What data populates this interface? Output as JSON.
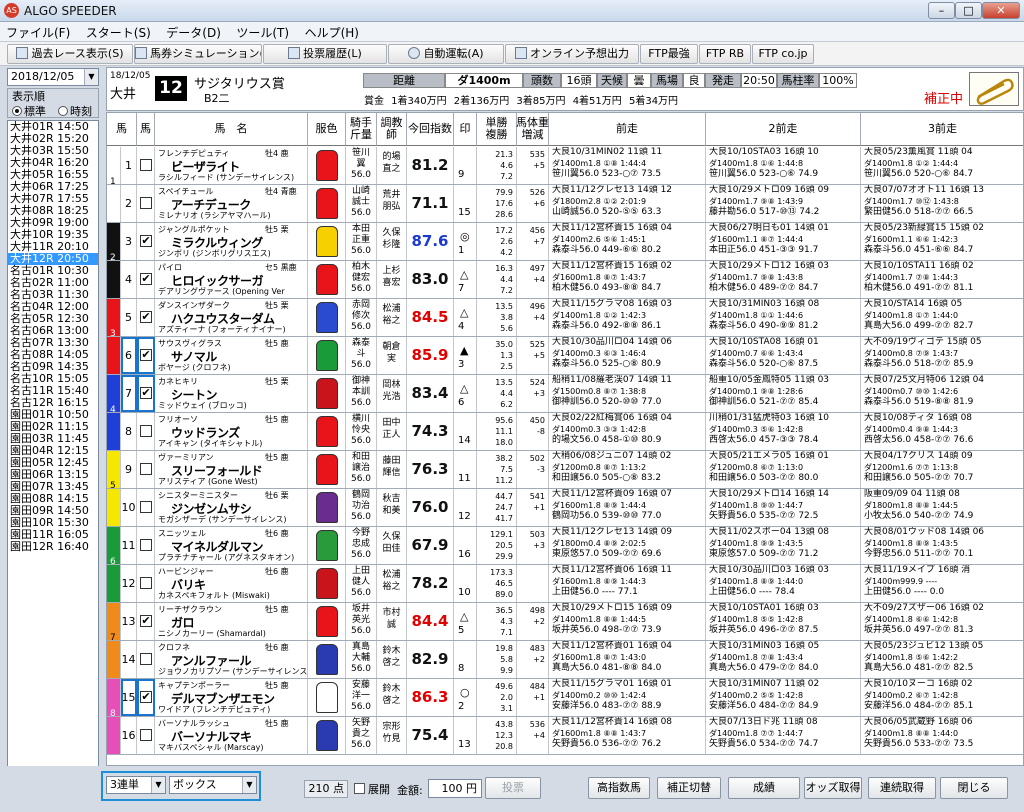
{
  "window": {
    "title": "ALGO SPEEDER",
    "app_icon": "AS"
  },
  "menu": [
    "ファイル(F)",
    "スタート(S)",
    "データ(D)",
    "ツール(T)",
    "ヘルプ(H)"
  ],
  "toolbar": [
    {
      "label": "過去レース表示(S)",
      "icon": "search-icon"
    },
    {
      "label": "馬券シミュレーション(B)",
      "icon": "calculator-icon"
    },
    {
      "label": "投票履歴(L)",
      "icon": "document-icon"
    },
    {
      "label": "自動運転(A)",
      "icon": "clock-icon"
    },
    {
      "label": "オンライン予想出力",
      "icon": "document-icon"
    },
    {
      "label": "FTP最強"
    },
    {
      "label": "FTP RB"
    },
    {
      "label": "FTP co.jp"
    }
  ],
  "sidebar": {
    "date": "2018/12/05",
    "order_label": "表示順",
    "order_options": [
      "標準",
      "時刻"
    ],
    "order_selected": "標準",
    "races": [
      "大井01R 14:50",
      "大井02R 15:20",
      "大井03R 15:50",
      "大井04R 16:20",
      "大井05R 16:55",
      "大井06R 17:25",
      "大井07R 17:55",
      "大井08R 18:25",
      "大井09R 19:00",
      "大井10R 19:35",
      "大井11R 20:10",
      "大井12R 20:50",
      "名古01R 10:30",
      "名古02R 11:00",
      "名古03R 11:30",
      "名古04R 12:00",
      "名古05R 12:30",
      "名古06R 13:00",
      "名古07R 13:30",
      "名古08R 14:05",
      "名古09R 14:35",
      "名古10R 15:05",
      "名古11R 15:40",
      "名古12R 16:15",
      "園田01R 10:50",
      "園田02R 11:15",
      "園田03R 11:45",
      "園田04R 12:15",
      "園田05R 12:45",
      "園田06R 13:15",
      "園田07R 13:45",
      "園田08R 14:15",
      "園田09R 14:50",
      "園田10R 15:30",
      "園田11R 16:05",
      "園田12R 16:40"
    ],
    "selected_race": "大井12R 20:50"
  },
  "race": {
    "date": "18/12/05",
    "venue": "大井",
    "number": "12",
    "name": "サジタリウス賞",
    "class": "B2二",
    "distance_label": "距離",
    "distance": "ダ1400m",
    "runners_label": "頭数",
    "runners": "16頭",
    "weather_label": "天候",
    "weather": "曇",
    "going_label": "馬場",
    "going": "良",
    "post_time_label": "発走",
    "post_time": "20:50",
    "post_rate_label": "馬柱率",
    "post_rate": "100%",
    "prizes": "賞金 1着340万円 2着136万円 3着85万円 4着51万円 5着34万円",
    "status": "補正中"
  },
  "columns": [
    "馬",
    "馬",
    "馬　名",
    "服色",
    "騎手\n斤量",
    "調教\n師",
    "今回指数",
    "印",
    "単勝\n複勝",
    "馬体重\n増減",
    "前走",
    "2前走",
    "3前走"
  ],
  "horses": [
    {
      "waku": "1",
      "num": "1",
      "checked": false,
      "sire": "フレンチデピュティ",
      "sex_age": "牡4 鹿",
      "name": "ビーザライト",
      "dam": "ラシルフィード (サンデーサイレンス)",
      "jockey": "笹川\n翼\n56.0",
      "trainer": "的場\n直之",
      "index": "81.2",
      "mark": "",
      "pop": "9",
      "odds": "21.3\n4.6\n7.2",
      "weight": "535\n+5\n",
      "p1": [
        "大良10/31MIN02 11頭 11",
        "ダ1400m1.8 ①⑧ 1:44:4",
        "笹川翼56.0 523-○⑦ 73.5"
      ],
      "p2": [
        "大良10/10STA03 16頭 10",
        "ダ1400m1.8 ①⑥ 1:44:8",
        "笹川翼56.0 523-○⑥ 74.9"
      ],
      "p3": [
        "大良05/23薫風賞 11頭 04",
        "ダ1400m1.8 ①② 1:44:4",
        "笹川翼56.0 520-○⑥ 84.7"
      ]
    },
    {
      "waku": "1",
      "num": "2",
      "checked": false,
      "sire": "スペイチュール",
      "sex_age": "牡4 青鹿",
      "name": "アーチデューク",
      "dam": "ミレナリオ (ラシアヤマハール)",
      "jockey": "山崎\n誠士\n56.0",
      "trainer": "荒井\n朋弘",
      "index": "71.1",
      "mark": "",
      "pop": "15",
      "odds": "79.9\n17.6\n28.6",
      "weight": "526\n+6\n",
      "p1": [
        "大良11/12クレセ13 14頭 12",
        "ダ1800m2.8 ①② 2:01:9",
        "山崎誠56.0 520-⑤⑤ 63.3"
      ],
      "p2": [
        "大良10/29メトロ09 16頭 09",
        "ダ1400m1.7 ⑨⑧ 1:43:9",
        "藤井勘56.0 517-⑩⑬ 74.2"
      ],
      "p3": [
        "大良07/07オオト11 16頭 13",
        "ダ1400m1.7 ⑩⑫ 1:43:8",
        "繁田健56.0 518-⑦⑦ 66.5"
      ]
    },
    {
      "waku": "2",
      "num": "3",
      "checked": true,
      "sire": "ジャングルポケット",
      "sex_age": "牡5 栗",
      "name": "ミラクルウィング",
      "dam": "ジンボリ (ジンボリグリスエス)",
      "jockey": "本田\n正重\n56.0",
      "trainer": "久保\n杉隆",
      "index": "87.6",
      "mark": "◎",
      "pop": "1",
      "odds": "17.2\n2.6\n4.2",
      "weight": "456\n+7\n",
      "p1": [
        "大良11/12宮杯貴15 16頭 04",
        "ダ1400m2.6 ⑤⑥ 1:45:1",
        "森泰斗56.0 449-⑥⑥ 80.2"
      ],
      "p2": [
        "大良06/27明日も01 14頭 01",
        "ダ1600m1.1 ⑧⑦ 1:44:4",
        "本田正56.0 451-③③ 91.7"
      ],
      "p3": [
        "大良05/23新緑賞15 15頭 02",
        "ダ1600m1.1 ⑥⑥ 1:42:3",
        "森泰斗56.0 451-⑥⑥ 84.7"
      ]
    },
    {
      "waku": "2",
      "num": "4",
      "checked": true,
      "sire": "パイロ",
      "sex_age": "セ5 黒鹿",
      "name": "ヒロイックサーガ",
      "dam": "デアリングヴァース (Opening Ver",
      "jockey": "柏木\n健宏\n56.0",
      "trainer": "上杉\n喜宏",
      "index": "83.0",
      "mark": "△",
      "pop": "7",
      "odds": "16.3\n4.4\n7.2",
      "weight": "497\n+4\n",
      "p1": [
        "大良11/12宮杯貴15 16頭 02",
        "ダ1600m1.8 ⑧⑦ 1:43:7",
        "柏木健56.0 493-⑧⑧ 84.7"
      ],
      "p2": [
        "大良10/29メトロ12 16頭 03",
        "ダ1400m1.7 ⑨⑧ 1:43:8",
        "柏木健56.0 489-⑦⑦ 84.7"
      ],
      "p3": [
        "大良10/10STA11 16頭 02",
        "ダ1400m1.7 ⑦⑧ 1:44:3",
        "柏木健56.0 491-⑦⑦ 81.1"
      ]
    },
    {
      "waku": "3",
      "num": "5",
      "checked": true,
      "sire": "ダンスインザダーク",
      "sex_age": "牡5 栗",
      "name": "ハクユウスターダム",
      "dam": "アズティーナ (フォーティナイナー)",
      "jockey": "赤岡\n修次\n56.0",
      "trainer": "松浦\n裕之",
      "index": "84.5",
      "mark": "△",
      "pop": "4",
      "odds": "13.5\n3.8\n5.6",
      "weight": "496\n+4\n",
      "p1": [
        "大良11/15グラマ08 16頭 03",
        "ダ1400m1.8 ①② 1:42:3",
        "森泰斗56.0 492-⑧⑧ 86.1"
      ],
      "p2": [
        "大良10/31MIN03 16頭 08",
        "ダ1400m1.8 ①① 1:44:6",
        "森泰斗56.0 490-⑨⑨ 81.2"
      ],
      "p3": [
        "大良10/STA14 16頭 05",
        "ダ1400m1.8 ①⑦ 1:44:0",
        "真島大56.0 499-⑦⑦ 82.7"
      ]
    },
    {
      "waku": "3",
      "num": "6",
      "checked": true,
      "sire": "サウスヴィグラス",
      "sex_age": "牡5 鹿",
      "name": "サノマル",
      "dam": "ボヤージ (クロフネ)",
      "jockey": "森泰\n斗\n56.0",
      "trainer": "朝倉\n実",
      "index": "85.9",
      "mark": "▲",
      "pop": "3",
      "odds": "35.0\n1.3\n2.5",
      "weight": "525\n+5\n",
      "p1": [
        "大良10/30品川ロ04 14頭 06",
        "ダ1400m0.3 ⑥③ 1:46:4",
        "森泰斗56.0 525-○⑧ 80.9"
      ],
      "p2": [
        "大良10/10STA08 16頭 01",
        "ダ1400m0.7 ⑥⑥ 1:43:4",
        "森泰斗56.0 520-○⑥ 87.5"
      ],
      "p3": [
        "大不09/19ヴィゴテ 15頭 05",
        "ダ1400m0.8 ⑦⑨ 1:43:7",
        "森泰斗56.0 518-⑦⑦ 85.9"
      ]
    },
    {
      "waku": "4",
      "num": "7",
      "checked": true,
      "sire": "カネヒキリ",
      "sex_age": "牡5 栗",
      "name": "シートン",
      "dam": "ミッドウェイ (ブロッコ)",
      "jockey": "御神\n本訓\n56.0",
      "trainer": "岡林\n光浩",
      "index": "83.4",
      "mark": "△",
      "pop": "6",
      "odds": "13.5\n4.4\n6.2",
      "weight": "524\n+3\n",
      "p1": [
        "船稍11/08羅老渓07 14頭 11",
        "ダ1500m0.8 ⑧⑦ 1:38:8",
        "御神訓56.0 520-⑩⑩ 77.0"
      ],
      "p2": [
        "船重10/05金鳳特05 11頭 03",
        "ダ1400m0.1 ⑨⑧ 1:28:6",
        "御神訓56.0 521-⑦⑦ 85.4"
      ],
      "p3": [
        "大良07/25文月特06 12頭 04",
        "ダ1400m0.7 ⑩⑩ 1:42:6",
        "森泰斗56.0 519-⑧⑧ 81.9"
      ]
    },
    {
      "waku": "4",
      "num": "8",
      "checked": false,
      "sire": "フリオーソ",
      "sex_age": "牡5 鹿",
      "name": "ウッドランズ",
      "dam": "アイキャン (タイキシャトル)",
      "jockey": "横川\n怜央\n56.0",
      "trainer": "田中\n正人",
      "index": "74.3",
      "mark": "",
      "pop": "14",
      "odds": "95.6\n11.1\n18.0",
      "weight": "450\n-8\n",
      "p1": [
        "大良02/22紅梅賞06 16頭 04",
        "ダ1400m0.3 ③③ 1:42:8",
        "的場文56.0 458-①⑩ 80.9"
      ],
      "p2": [
        "川稍01/31猛虎特03 16頭 10",
        "ダ1400m0.3 ⑤⑥ 1:42:8",
        "西啓太56.0 457-③③ 78.4"
      ],
      "p3": [
        "大良10/08ティタ 16頭 08",
        "ダ1400m0.4 ⑨⑧ 1:44:3",
        "西啓太56.0 458-⑦⑦ 76.6"
      ]
    },
    {
      "waku": "5",
      "num": "9",
      "checked": false,
      "sire": "ヴァーミリアン",
      "sex_age": "牡5 鹿",
      "name": "スリーフォールド",
      "dam": "アリスティア (Gone West)",
      "jockey": "和田\n譲治\n56.0",
      "trainer": "藤田\n輝信",
      "index": "76.3",
      "mark": "",
      "pop": "11",
      "odds": "38.2\n7.5\n11.2",
      "weight": "502\n-3\n",
      "p1": [
        "大稍06/08ジュニ07 14頭 02",
        "ダ1200m0.8 ⑧⑦ 1:13:2",
        "和田譲56.0 505-○⑧ 83.2"
      ],
      "p2": [
        "大良05/21エメラ05 16頭 01",
        "ダ1200m0.8 ⑥⑦ 1:13:0",
        "和田譲56.0 503-⑦⑦ 80.0"
      ],
      "p3": [
        "大良04/17クリス 14頭 09",
        "ダ1200m1.6 ⑦⑦ 1:13:8",
        "和田譲56.0 505-⑦⑦ 70.7"
      ]
    },
    {
      "waku": "5",
      "num": "10",
      "checked": false,
      "sire": "シニスターミニスター",
      "sex_age": "牡6 栗",
      "name": "ジンゼンムサシ",
      "dam": "モガシザーデ (サンデーサイレンス)",
      "jockey": "鶴岡\n功治\n56.0",
      "trainer": "秋吉\n和美",
      "index": "76.0",
      "mark": "",
      "pop": "12",
      "odds": "44.7\n24.7\n41.7",
      "weight": "541\n+1\n",
      "p1": [
        "大良11/12宮杯貴09 16頭 07",
        "ダ1600m1.8 ⑧⑨ 1:44:4",
        "鶴岡功56.0 539-⑩⑩ 77.0"
      ],
      "p2": [
        "大良10/29メトロ14 16頭 14",
        "ダ1400m1.8 ⑨⑩ 1:44:7",
        "矢野貴56.0 535-⑦⑦ 72.5"
      ],
      "p3": [
        "阪重09/09 04 11頭 08",
        "ダ1800m1.8 ⑧⑧ 1:44:5",
        "小牧太56.0 540-⑦⑦ 74.9"
      ]
    },
    {
      "waku": "6",
      "num": "11",
      "checked": false,
      "sire": "スニッツェル",
      "sex_age": "牡6 鹿",
      "name": "マイネルダルマン",
      "dam": "プラチナチャール (アグネスタキオン)",
      "jockey": "今野\n忠成\n56.0",
      "trainer": "久保\n田佳",
      "index": "67.9",
      "mark": "",
      "pop": "16",
      "odds": "129.1\n20.5\n29.9",
      "weight": "503\n+3\n",
      "p1": [
        "大良11/12クレセ13 14頭 09",
        "ダ1800m0.4 ⑧⑨ 2:02:5",
        "東原悠57.0 509-⑦⑦ 69.6"
      ],
      "p2": [
        "大良11/02スポー04 13頭 08",
        "ダ1400m1.8 ⑨⑨ 1:43:5",
        "東原悠57.0 509-⑦⑦ 71.2"
      ],
      "p3": [
        "大良08/01ウッド08 14頭 06",
        "ダ1400m1.8 ⑧⑨ 1:43:5",
        "今野忠56.0 511-⑦⑦ 70.1"
      ]
    },
    {
      "waku": "6",
      "num": "12",
      "checked": false,
      "sire": "ハービンジャー",
      "sex_age": "牡6 鹿",
      "name": "バリキ",
      "dam": "カネスペキフォルト (Miswaki)",
      "jockey": "上田\n健人\n56.0",
      "trainer": "松浦\n裕之",
      "index": "78.2",
      "mark": "",
      "pop": "10",
      "odds": "173.3\n46.5\n89.0",
      "weight": "",
      "p1": [
        "大良11/12宮杯貴06 16頭 11",
        "ダ1600m1.8 ⑧⑨ 1:44:3",
        "上田健56.0 ---- 77.1"
      ],
      "p2": [
        "大良10/30品川ロ03 16頭 03",
        "ダ1400m1.8 ⑧⑨ 1:44:0",
        "上田健56.0 ---- 78.4"
      ],
      "p3": [
        "大良11/19メイプ 16頭 消",
        "ダ1400m999.9 ----",
        "上田健56.0 ---- 0.0"
      ]
    },
    {
      "waku": "7",
      "num": "13",
      "checked": true,
      "sire": "リーチザクラウン",
      "sex_age": "牡5 鹿",
      "name": "ガロ",
      "dam": "ニシノカーリー (Shamardal)",
      "jockey": "坂井\n英光\n56.0",
      "trainer": "市村\n誠",
      "index": "84.4",
      "mark": "△",
      "pop": "5",
      "odds": "36.5\n4.3\n7.1",
      "weight": "498\n+2\n",
      "p1": [
        "大良10/29メトロ15 16頭 09",
        "ダ1400m1.8 ⑧⑧ 1:44:5",
        "坂井英56.0 498-⑦⑦ 73.9"
      ],
      "p2": [
        "大良10/10STA01 16頭 03",
        "ダ1400m1.8 ⑤⑤ 1:42:8",
        "坂井英56.0 496-⑦⑦ 87.5"
      ],
      "p3": [
        "大不09/27ズザー06 16頭 02",
        "ダ1400m1.8 ⑥⑥ 1:42:8",
        "坂井英56.0 497-⑦⑦ 81.3"
      ]
    },
    {
      "waku": "7",
      "num": "14",
      "checked": false,
      "sire": "クロフネ",
      "sex_age": "牡6 鹿",
      "name": "アンルファール",
      "dam": "ジョウノカリプソー (サンデーサイレンス)",
      "jockey": "真島\n大輔\n56.0",
      "trainer": "鈴木\n啓之",
      "index": "82.9",
      "mark": "",
      "pop": "8",
      "odds": "19.8\n5.8\n9.9",
      "weight": "483\n+2\n",
      "p1": [
        "大良11/12宮杯貴01 16頭 04",
        "ダ1600m1.8 ⑧⑦ 1:43:0",
        "真島大56.0 481-⑧⑧ 84.0"
      ],
      "p2": [
        "大良10/31MIN03 16頭 05",
        "ダ1400m1.8 ⑦⑧ 1:43:4",
        "真島大56.0 479-⑦⑦ 84.0"
      ],
      "p3": [
        "大良05/23ジュビ12 13頭 05",
        "ダ1400m1.8 ⑤⑥ 1:42:2",
        "真島大56.0 481-⑦⑦ 82.5"
      ]
    },
    {
      "waku": "8",
      "num": "15",
      "checked": true,
      "sire": "キャプテンポーラー",
      "sex_age": "牡5 鹿",
      "name": "デルマブンザエモン",
      "dam": "ワイドア (フレンチデピュティ)",
      "jockey": "安藤\n洋一\n56.0",
      "trainer": "鈴木\n啓之",
      "index": "86.3",
      "mark": "○",
      "pop": "2",
      "odds": "49.6\n2.0\n3.1",
      "weight": "484\n+1\n",
      "p1": [
        "大良11/15グラマ01 16頭 01",
        "ダ1400m0.2 ⑩⑩ 1:42:4",
        "安藤洋56.0 483-⑦⑦ 88.9"
      ],
      "p2": [
        "大良10/31MIN07 11頭 02",
        "ダ1400m0.2 ⑤⑤ 1:42:8",
        "安藤洋56.0 484-⑦⑦ 84.9"
      ],
      "p3": [
        "大良10/10ヌーコ 16頭 02",
        "ダ1400m0.2 ⑥⑦ 1:42:8",
        "安藤洋56.0 484-⑦⑦ 85.1"
      ]
    },
    {
      "waku": "8",
      "num": "16",
      "checked": false,
      "sire": "バーソナルラッシュ",
      "sex_age": "牡5 鹿",
      "name": "バーソナルマキ",
      "dam": "マキバスペシャル (Marscay)",
      "jockey": "矢野\n貴之\n56.0",
      "trainer": "宗形\n竹見",
      "index": "75.4",
      "mark": "",
      "pop": "13",
      "odds": "43.8\n12.3\n20.8",
      "weight": "536\n+4\n",
      "p1": [
        "大良11/12宮杯貴14 16頭 08",
        "ダ1600m1.8 ⑧⑧ 1:43:7",
        "矢野貴56.0 536-⑦⑦ 76.2"
      ],
      "p2": [
        "大良07/13日ド兆 11頭 08",
        "ダ1400m1.8 ⑦⑦ 1:44:7",
        "矢野貴56.0 534-⑦⑦ 74.7"
      ],
      "p3": [
        "大良06/05武蔵野 16頭 06",
        "ダ1400m1.8 ⑧⑧ 1:44:0",
        "矢野貴56.0 533-⑦⑦ 73.5"
      ]
    }
  ],
  "waku_colors": {
    "1": "#ffffff",
    "2": "#111111",
    "3": "#e8141a",
    "4": "#1f3fd8",
    "5": "#f6e700",
    "6": "#1a9b3a",
    "7": "#f08a1a",
    "8": "#e64fb8"
  },
  "silk_colors": [
    "#e8141a",
    "#e8141a",
    "#f6d000",
    "#e8141a",
    "#2a4ad0",
    "#1a9b3a",
    "#c8141a",
    "#e8141a",
    "#e8141a",
    "#6a2d8f",
    "#2a9b3a",
    "#c8141a",
    "#e8141a",
    "#2a3ab0",
    "#ffffff",
    "#2a3ab0"
  ],
  "bottom": {
    "bet_type": "3連単",
    "bet_mode": "ボックス",
    "points": "210",
    "points_unit": "点",
    "expand_label": "展開",
    "amount_label": "金額:",
    "amount": "100",
    "amount_unit": "円",
    "buttons": [
      "投票",
      "高指数馬",
      "補正切替",
      "成績",
      "オッズ取得",
      "連続取得",
      "閉じる"
    ]
  }
}
